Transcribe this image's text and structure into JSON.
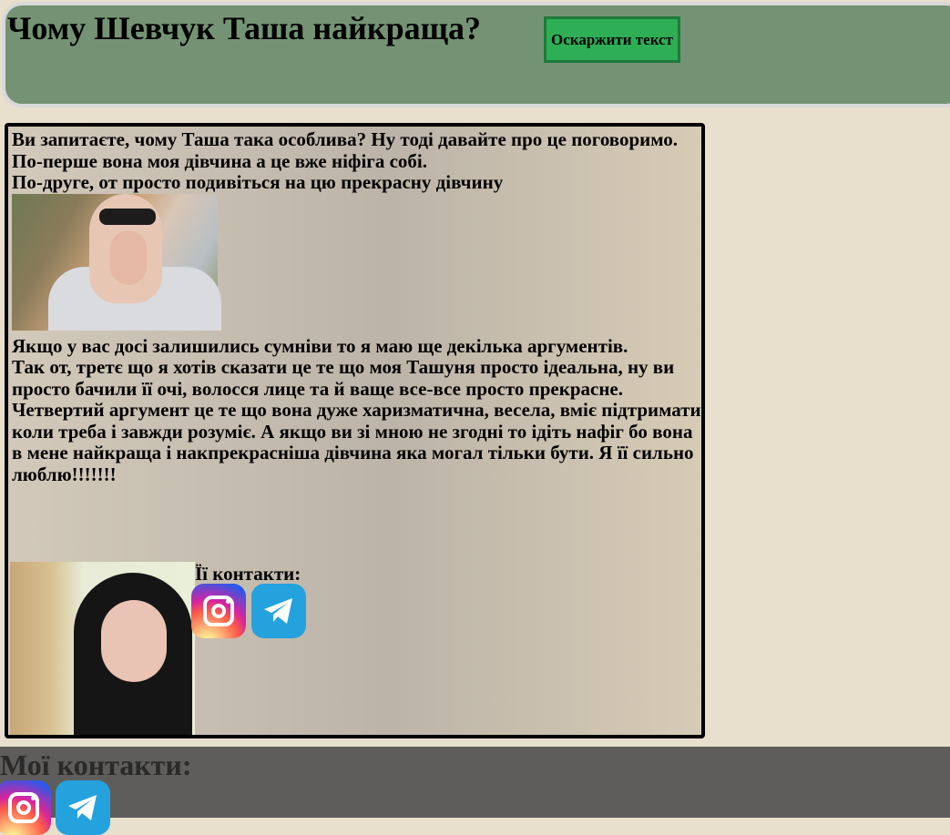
{
  "header": {
    "title": "Чому Шевчук Таша найкраща?",
    "button_label": "Оскаржити текст"
  },
  "content": {
    "paragraph1": "Ви запитаєте, чому Таша така особлива? Ну тоді давайте про це поговоримо.\nПо-перше вона моя дівчина а це вже ніфіга собі.\nПо-друге, от просто подивіться на цю прекрасну дівчину",
    "paragraph2": "Якщо у вас досі залишились сумніви то я маю ще декілька аргументів.\nТак от, третє що я хотів сказати це те що моя Ташуня просто ідеальна, ну ви просто бачили її очі, волосся лице та й ваще все-все просто прекрасне.\nЧетвертий аргумент це те що вона дуже харизматична, весела, вміє підтримати коли треба і завжди розуміє. А якщо ви зі мною не згодні то ідіть нафіг бо вона в мене найкраща і накпрекрасніша дівчина яка могал тільки бути. Я її сильно люблю!!!!!!!",
    "her_contacts_label": "Її контакти:"
  },
  "footer": {
    "my_contacts_label": "Мої контакти:"
  },
  "icons": {
    "instagram": "instagram-icon",
    "telegram": "telegram-icon"
  },
  "colors": {
    "header_bg": "#749374",
    "button_bg": "#2eae55",
    "page_bg": "#e8dfcc",
    "footer_bg": "#5e5d5b"
  }
}
